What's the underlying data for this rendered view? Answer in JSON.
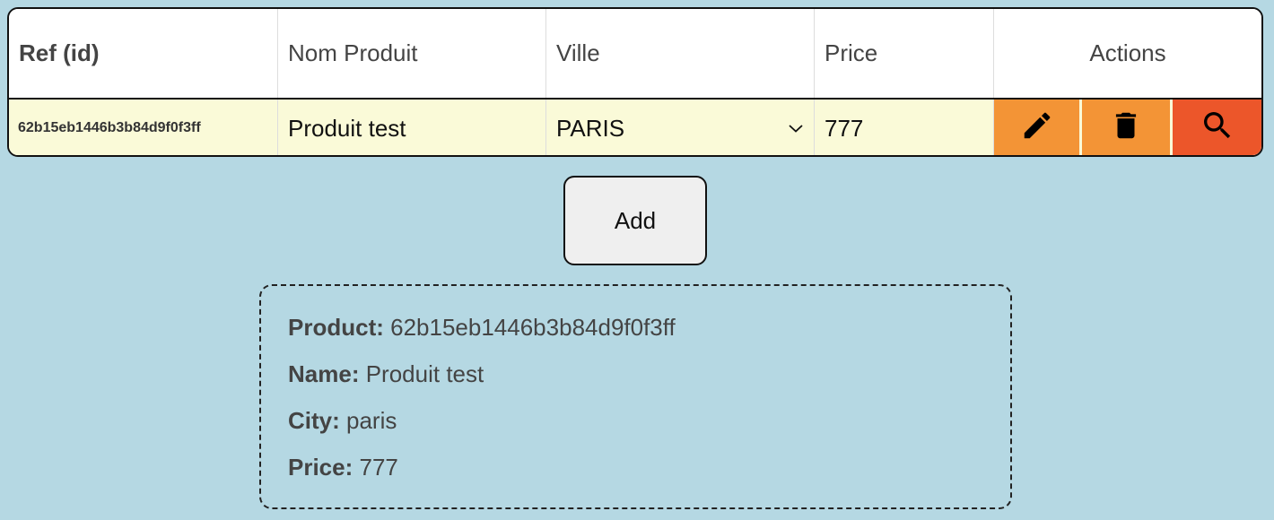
{
  "table": {
    "headers": {
      "ref": "Ref (id)",
      "name": "Nom Produit",
      "city": "Ville",
      "price": "Price",
      "actions": "Actions"
    },
    "row": {
      "id": "62b15eb1446b3b84d9f0f3ff",
      "name": "Produit test",
      "city": "PARIS",
      "price": "777"
    },
    "actions": {
      "edit_icon": "pencil-icon",
      "delete_icon": "trash-icon",
      "view_icon": "magnifier-icon"
    }
  },
  "add_button": {
    "label": "Add"
  },
  "detail": {
    "product_label": "Product:",
    "product_value": "62b15eb1446b3b84d9f0f3ff",
    "name_label": "Name:",
    "name_value": "Produit test",
    "city_label": "City:",
    "city_value": "paris",
    "price_label": "Price:",
    "price_value": "777"
  },
  "colors": {
    "background": "#b5d8e3",
    "row_background": "#fafad8",
    "edit_delete_button": "#f39436",
    "view_button": "#ec562a",
    "add_button": "#efefef"
  }
}
